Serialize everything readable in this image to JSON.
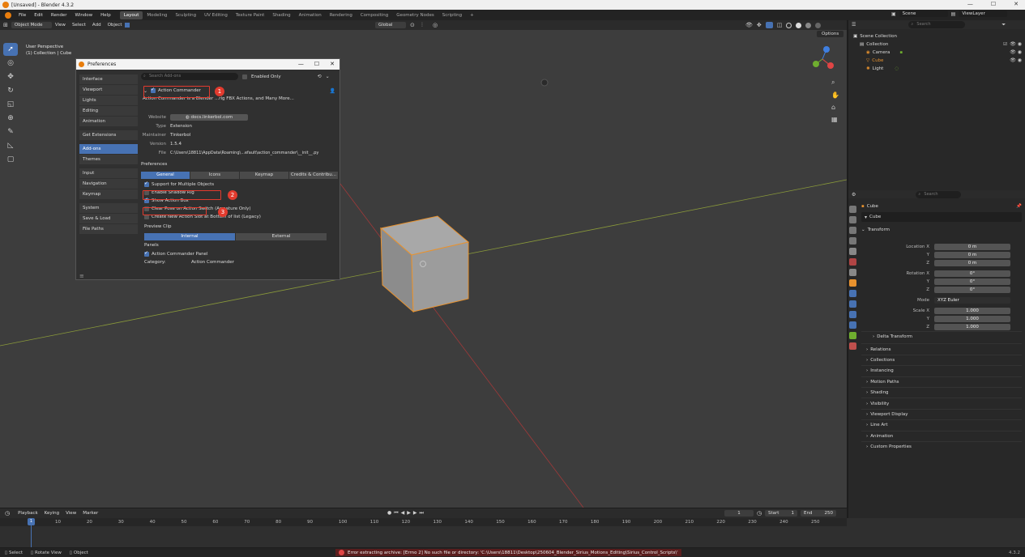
{
  "window": {
    "title": "[Unsaved] - Blender 4.3.2",
    "minimize": "—",
    "maximize": "☐",
    "close": "✕"
  },
  "topbar": {
    "menus": [
      "File",
      "Edit",
      "Render",
      "Window",
      "Help"
    ],
    "workspaces": [
      "Layout",
      "Modeling",
      "Sculpting",
      "UV Editing",
      "Texture Paint",
      "Shading",
      "Animation",
      "Rendering",
      "Compositing",
      "Geometry Nodes",
      "Scripting"
    ],
    "active_workspace": "Layout",
    "add_tab": "+",
    "scene": "Scene",
    "view_layer": "ViewLayer"
  },
  "viewport_header": {
    "mode": "Object Mode",
    "menus": [
      "View",
      "Select",
      "Add",
      "Object"
    ],
    "transform_orientation": "Global",
    "options": "Options"
  },
  "viewport": {
    "perspective": "User Perspective",
    "collection": "(1) Collection | Cube",
    "gizmo_axes": [
      "X",
      "Y",
      "Z"
    ]
  },
  "preferences": {
    "title": "Preferences",
    "sidebar": [
      [
        "Interface",
        "Viewport",
        "Lights",
        "Editing",
        "Animation"
      ],
      [
        "Get Extensions"
      ],
      [
        "Add-ons",
        "Themes"
      ],
      [
        "Input",
        "Navigation",
        "Keymap"
      ],
      [
        "System",
        "Save & Load",
        "File Paths"
      ]
    ],
    "selected": "Add-ons",
    "search_placeholder": "Search Add-ons",
    "enabled_only": "Enabled Only",
    "addon": {
      "name": "Action Commander",
      "description": "Action Commander is a Blender ...rig FBX Actions, and Many More...",
      "website_key": "Website",
      "website": "docs.linkerbol.com",
      "type_key": "Type",
      "type": "Extension",
      "maintainer_key": "Maintainer",
      "maintainer": "Tinkerbol",
      "version_key": "Version",
      "version": "1.5.4",
      "file_key": "File",
      "file": "C:\\Users\\18811\\AppData\\Roaming\\...efault\\action_commander\\__init__.py"
    },
    "preferences_label": "Preferences",
    "tabs": [
      "General",
      "Icons",
      "Keymap",
      "Credits & Contribu..."
    ],
    "options": [
      {
        "label": "Support for Multiple Objects",
        "checked": true
      },
      {
        "label": "Enable Shadow Rig",
        "checked": false
      },
      {
        "label": "Show Action Box",
        "checked": true
      },
      {
        "label": "Clear Pose on Action Switch (Armature Only)",
        "checked": false
      },
      {
        "label": "Create New Action Slot at Bottom of list (Legacy)",
        "checked": false
      }
    ],
    "preview_clip": "Preview Clip",
    "clip_tabs": [
      "Internal",
      "External"
    ],
    "panels_label": "Panels",
    "panel_option": "Action Commander Panel",
    "category_key": "Category:",
    "category_value": "Action Commander",
    "annotations": [
      "1",
      "2",
      "3"
    ]
  },
  "outliner": {
    "root": "Scene Collection",
    "collection": "Collection",
    "items": [
      "Camera",
      "Cube",
      "Light"
    ],
    "search_placeholder": "Search"
  },
  "properties": {
    "object_name": "Cube",
    "data_name": "Cube",
    "search_placeholder": "Search",
    "transform": "Transform",
    "location_label": "Location X",
    "rotation_label": "Rotation X",
    "scale_label": "Scale X",
    "axis_y": "Y",
    "axis_z": "Z",
    "location": [
      "0 m",
      "0 m",
      "0 m"
    ],
    "rotation": [
      "0°",
      "0°",
      "0°"
    ],
    "mode_label": "Mode",
    "mode": "XYZ Euler",
    "scale": [
      "1.000",
      "1.000",
      "1.000"
    ],
    "delta": "Delta Transform",
    "sections": [
      "Relations",
      "Collections",
      "Instancing",
      "Motion Paths",
      "Shading",
      "Visibility",
      "Viewport Display",
      "Line Art",
      "Animation",
      "Custom Properties"
    ]
  },
  "timeline": {
    "menus": [
      "Playback",
      "Keying",
      "View",
      "Marker"
    ],
    "current_frame": "1",
    "start_label": "Start",
    "start": "1",
    "end_label": "End",
    "end": "250",
    "ruler": [
      "1",
      "10",
      "20",
      "30",
      "40",
      "50",
      "60",
      "70",
      "80",
      "90",
      "100",
      "110",
      "120",
      "130",
      "140",
      "150",
      "160",
      "170",
      "180",
      "190",
      "200",
      "210",
      "220",
      "230",
      "240",
      "250"
    ]
  },
  "statusbar": {
    "hints": [
      "Select",
      "Rotate View",
      "Object"
    ],
    "error": "Error extracting archive: [Errno 2] No such file or directory: 'C:\\Users\\18811\\Desktop\\250604_Blender_Sirius_Motions_Editing\\Sirius_Control_Scripts\\'",
    "version": "4.3.2"
  },
  "colors": {
    "accent": "#4772b3",
    "annotation": "#e23b2e",
    "selection_outline": "#e8922e"
  }
}
